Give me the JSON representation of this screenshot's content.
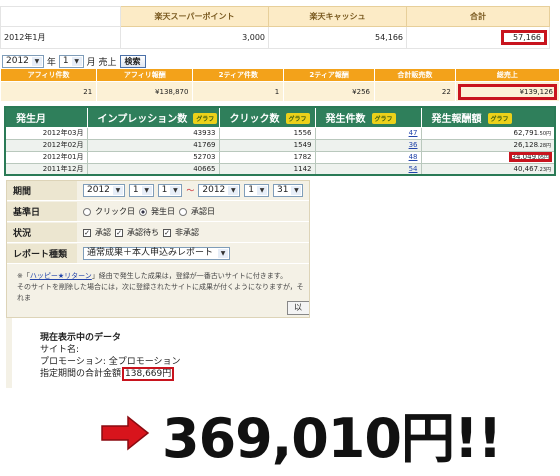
{
  "panel1": {
    "headers": [
      "",
      "楽天スーパーポイント",
      "楽天キャッシュ",
      "合計"
    ],
    "row": [
      "2012年1月",
      "3,000",
      "54,166",
      "57,166"
    ]
  },
  "panel2": {
    "year": "2012",
    "year_unit": "年",
    "month": "1",
    "month_unit": "月 売上",
    "search_label": "検索",
    "headers": [
      "アフィリ件数",
      "アフィリ報酬",
      "2ティア件数",
      "2ティア報酬",
      "合計販売数",
      "総売上"
    ],
    "row": [
      "21",
      "¥138,870",
      "1",
      "¥256",
      "22",
      "¥139,126"
    ]
  },
  "panel3": {
    "headers": [
      "発生月",
      "インプレッション数",
      "クリック数",
      "発生件数",
      "発生報酬額"
    ],
    "graph_label": "グラフ",
    "rows": [
      [
        "2012年03月",
        "43933",
        "1556",
        "47",
        "62,791",
        ".50円"
      ],
      [
        "2012年02月",
        "41769",
        "1549",
        "36",
        "26,128",
        ".28円"
      ],
      [
        "2012年01月",
        "52703",
        "1782",
        "48",
        "34,049",
        ".05円"
      ],
      [
        "2011年12月",
        "40665",
        "1142",
        "54",
        "40,467",
        ".23円"
      ]
    ]
  },
  "panel4": {
    "period_label": "期間",
    "from_year": "2012",
    "from_month": "1",
    "from_day": "1",
    "tilde": "～",
    "to_year": "2012",
    "to_month": "1",
    "to_day": "31",
    "basis_label": "基準日",
    "basis_options": [
      "クリック日",
      "発生日",
      "承認日"
    ],
    "status_label": "状況",
    "status_options": [
      "承認",
      "承認待ち",
      "非承認"
    ],
    "report_label": "レポート種類",
    "report_value": "通常成果＋本人申込みレポート",
    "note_prefix": "※「",
    "note_link": "ハッピー★リターン",
    "note_line1": "」経由で発生した成果は，登録が一番古いサイトに付きます。",
    "note_line2": "そのサイトを削除した場合には，次に登録されたサイトに成果が付くようになりますが，それま",
    "button_label": "以"
  },
  "panel5": {
    "title": "現在表示中のデータ",
    "site_label": "サイト名:",
    "promo": "プロモーション: 全プロモーション",
    "total_label": "指定期間の合計金額:",
    "total_value": "138,669円"
  },
  "big_total": "369,010円!!",
  "colors": {
    "highlight": "#c8141e",
    "orange": "#f3a21a",
    "green": "#2f7f5b"
  }
}
